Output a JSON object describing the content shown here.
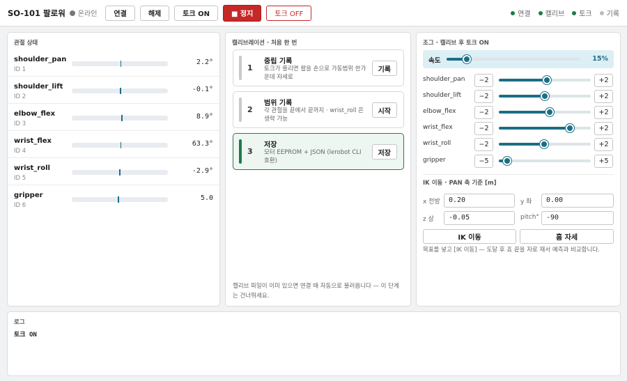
{
  "header": {
    "title": "SO-101 팔로워",
    "online_label": "온라인",
    "buttons": {
      "connect": "연결",
      "disconnect": "해제",
      "torque_on": "토크 ON",
      "stop": "■ 정지",
      "torque_off": "토크 OFF"
    },
    "status": {
      "connect": "연결",
      "calib": "캘리브",
      "torque": "토크",
      "record": "기록"
    }
  },
  "joints": {
    "title": "관절 상태",
    "rows": [
      {
        "name": "shoulder_pan",
        "id": "ID 1",
        "value": "2.2°"
      },
      {
        "name": "shoulder_lift",
        "id": "ID 2",
        "value": "-0.1°"
      },
      {
        "name": "elbow_flex",
        "id": "ID 3",
        "value": "8.9°"
      },
      {
        "name": "wrist_flex",
        "id": "ID 4",
        "value": "63.3°"
      },
      {
        "name": "wrist_roll",
        "id": "ID 5",
        "value": "-2.9°"
      },
      {
        "name": "gripper",
        "id": "ID 6",
        "value": "5.0"
      }
    ]
  },
  "calibration": {
    "title": "캘리브레이션 · 처음 한 번",
    "steps": [
      {
        "num": "1",
        "title": "중립 기록",
        "desc": "토크가 풀리면 팔을 손으로 가동범위 한가운데 자세로",
        "button": "기록"
      },
      {
        "num": "2",
        "title": "범위 기록",
        "desc": "각 관절을 끝에서 끝까지 · wrist_roll 은 생략 가능",
        "button": "시작"
      },
      {
        "num": "3",
        "title": "저장",
        "desc": "모터 EEPROM + JSON (lerobot CLI 호환)",
        "button": "저장"
      }
    ],
    "note": "캘리브 파일이 이미 있으면 연결 때 자동으로 불러옵니다 — 이 단계는 건너뛰세요."
  },
  "jog": {
    "title": "조그 · 캘리브 후 토크 ON",
    "speed_label": "속도",
    "speed_value": "15%",
    "speed_fraction": 0.15,
    "rows": [
      {
        "name": "shoulder_pan",
        "minus": "−2",
        "plus": "+2",
        "level": 0.52
      },
      {
        "name": "shoulder_lift",
        "minus": "−2",
        "plus": "+2",
        "level": 0.5
      },
      {
        "name": "elbow_flex",
        "minus": "−2",
        "plus": "+2",
        "level": 0.55
      },
      {
        "name": "wrist_flex",
        "minus": "−2",
        "plus": "+2",
        "level": 0.77
      },
      {
        "name": "wrist_roll",
        "minus": "−2",
        "plus": "+2",
        "level": 0.49
      },
      {
        "name": "gripper",
        "minus": "−5",
        "plus": "+5",
        "level": 0.09
      }
    ]
  },
  "ik": {
    "title": "IK 이동 · PAN 축 기준 [m]",
    "x_label": "x 전방",
    "x_value": "0.20",
    "y_label": "y 좌",
    "y_value": "0.00",
    "z_label": "z 상",
    "z_value": "-0.05",
    "pitch_label": "pitch°",
    "pitch_value": "-90",
    "move_button": "IK 이동",
    "home_button": "홈 자세",
    "note": "목표를 넣고 [IK 이동] — 도달 후 죠 끝을 자로 재서 예측과 비교합니다."
  },
  "log": {
    "title": "로그",
    "lines": [
      "토크 ON"
    ]
  },
  "colors": {
    "accent": "#1a6e86",
    "stop": "#c62828",
    "ok": "#1e7a4a"
  }
}
